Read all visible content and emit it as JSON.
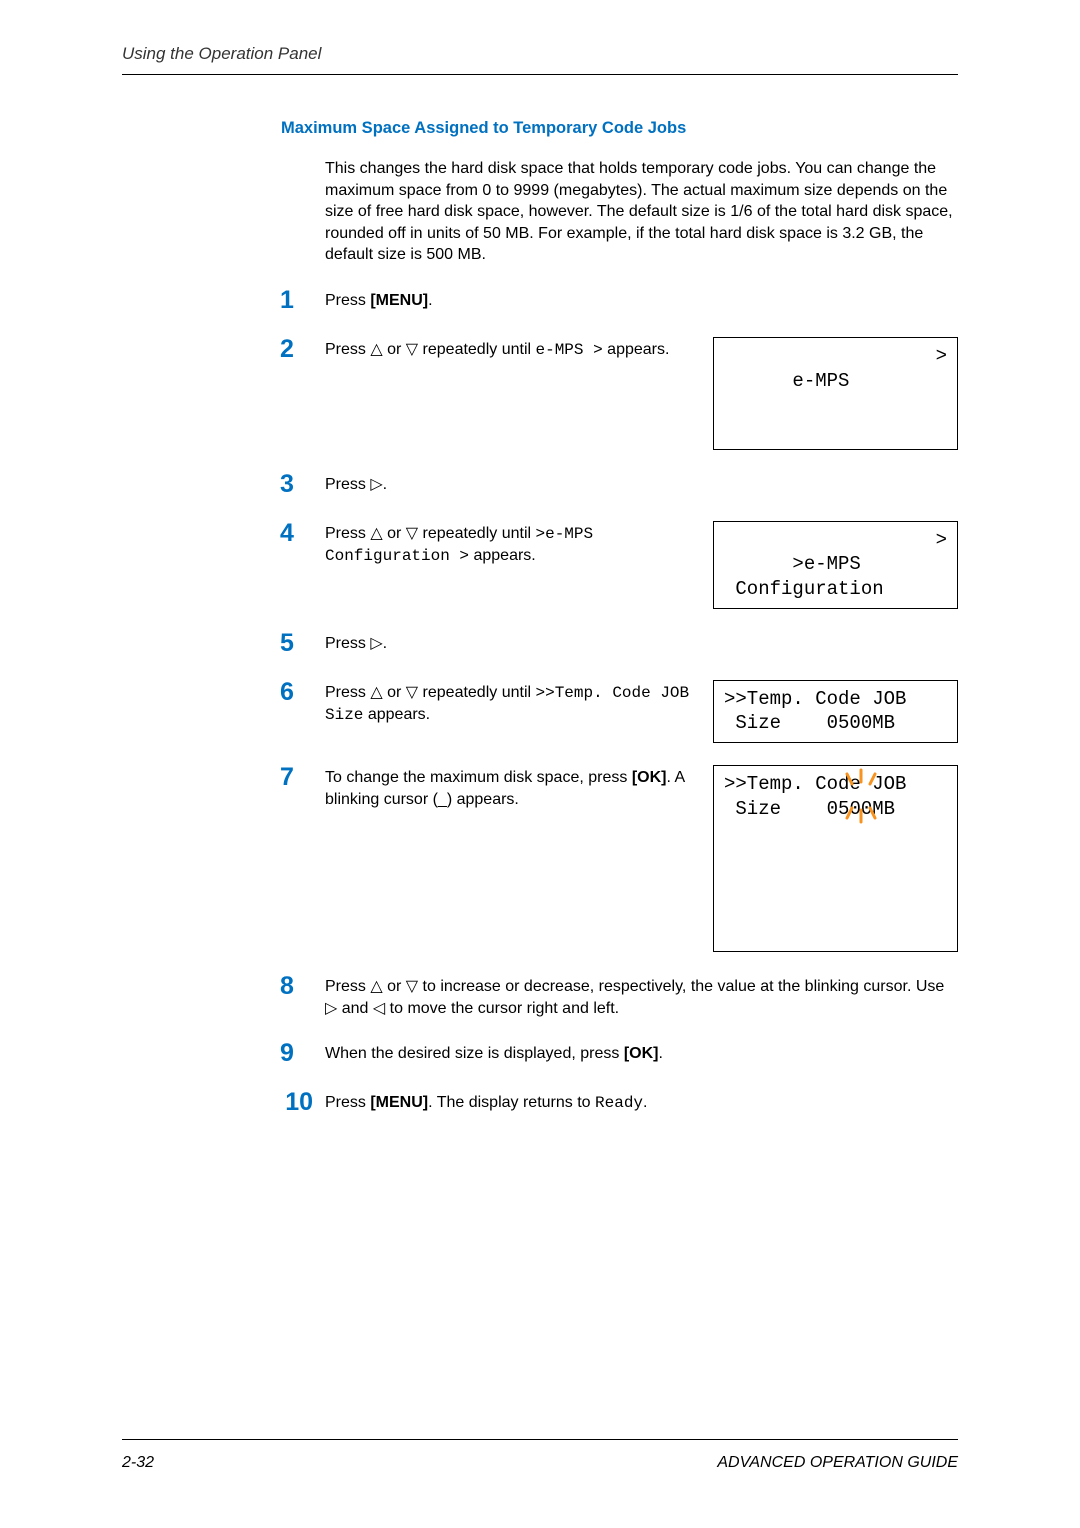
{
  "header": {
    "section_title": "Using the Operation Panel"
  },
  "section_heading": "Maximum Space Assigned to Temporary Code Jobs",
  "intro": "This changes the hard disk space that holds temporary code jobs. You can change the maximum space from 0 to 9999 (megabytes). The actual maximum size depends on the size of free hard disk space, however. The default size is 1/6 of the total hard disk space, rounded off in units of 50 MB. For example, if the total hard disk space is 3.2 GB, the default size is 500 MB.",
  "steps": {
    "s1": {
      "num": "1",
      "text_pre": "Press ",
      "bold": "[MENU]",
      "text_post": "."
    },
    "s2": {
      "num": "2",
      "text_pre": "Press ",
      "tri1": "△",
      "mid": " or ",
      "tri2": "▽",
      "text_post1": " repeatedly until ",
      "code": "e-MPS >",
      "text_post2": " appears."
    },
    "s3": {
      "num": "3",
      "text_pre": "Press ",
      "tri": "▷",
      "text_post": "."
    },
    "s4": {
      "num": "4",
      "text_pre": "Press ",
      "tri1": "△",
      "mid": " or ",
      "tri2": "▽",
      "text_post1": " repeatedly until ",
      "code": ">e-MPS Configuration >",
      "text_post2": " appears."
    },
    "s5": {
      "num": "5",
      "text_pre": "Press ",
      "tri": "▷",
      "text_post": "."
    },
    "s6": {
      "num": "6",
      "text_pre": "Press ",
      "tri1": "△",
      "mid": " or ",
      "tri2": "▽",
      "text_post1": " repeatedly until ",
      "code": ">>Temp. Code JOB Size",
      "text_post2": " appears."
    },
    "s7": {
      "num": "7",
      "text_pre": "To change the maximum disk space, press ",
      "bold": "[OK]",
      "text_post": ". A blinking cursor (_) appears."
    },
    "s8": {
      "num": "8",
      "text_pre": "Press ",
      "tri1": "△",
      "mid": " or ",
      "tri2": "▽",
      "text_mid1": " to increase or decrease, respectively, the value at the blinking cursor. Use ",
      "tri3": "▷",
      "mid2": " and ",
      "tri4": "◁",
      "text_post": " to move the cursor right and left."
    },
    "s9": {
      "num": "9",
      "text_pre": "When the desired size is displayed, press ",
      "bold": "[OK]",
      "text_post": "."
    },
    "s10": {
      "num": "10",
      "text_pre": "Press ",
      "bold": "[MENU]",
      "text_mid": ". The display returns to ",
      "code": "Ready",
      "text_post": "."
    }
  },
  "displays": {
    "d2": {
      "line1": "e-MPS",
      "caret": ">"
    },
    "d4": {
      "line1": ">e-MPS",
      "line2": " Configuration",
      "caret": ">"
    },
    "d6": {
      "line1": ">>Temp. Code JOB",
      "line2": " Size    0500MB"
    },
    "d7": {
      "line1": ">>Temp. Code JOB",
      "line2_pre": " Size    0",
      "cursor": "5",
      "line2_post": "00MB"
    }
  },
  "footer": {
    "page": "2-32",
    "book": "ADVANCED OPERATION GUIDE"
  }
}
